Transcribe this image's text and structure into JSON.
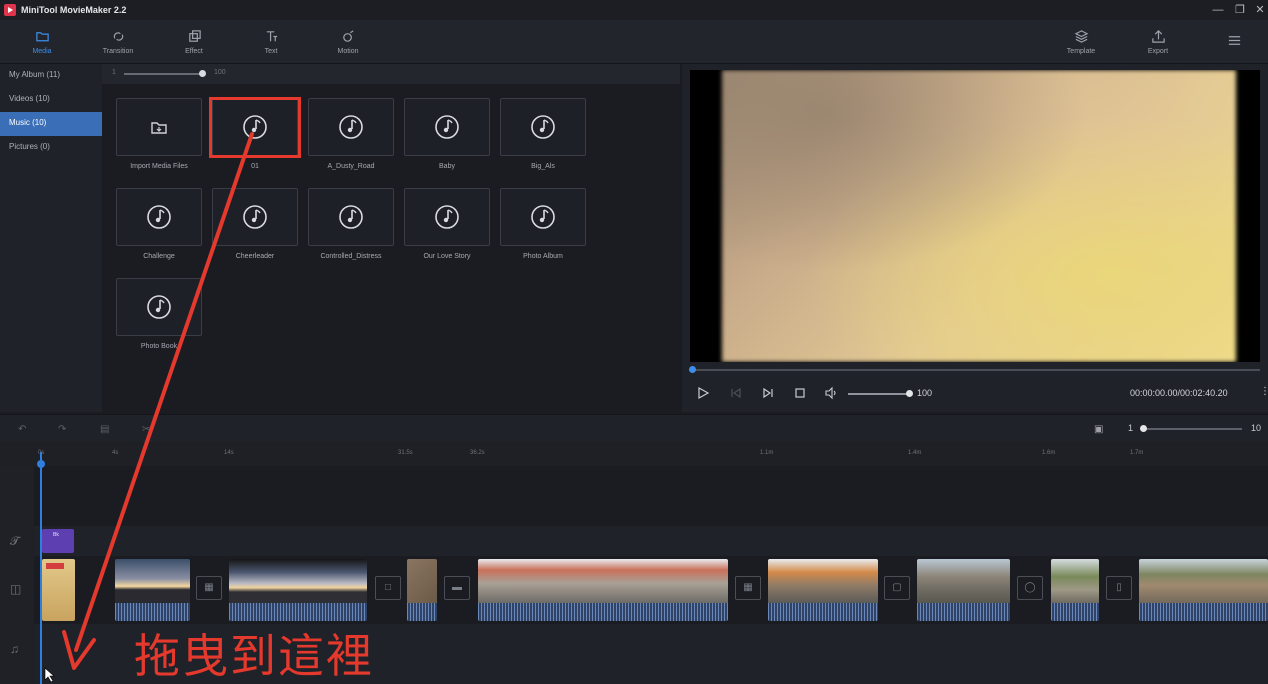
{
  "window": {
    "title": "MiniTool MovieMaker 2.2"
  },
  "toolbar": {
    "items": [
      {
        "label": "Media",
        "icon": "folder-icon",
        "active": true
      },
      {
        "label": "Transition",
        "icon": "transition-icon"
      },
      {
        "label": "Effect",
        "icon": "effect-icon"
      },
      {
        "label": "Text",
        "icon": "text-icon"
      },
      {
        "label": "Motion",
        "icon": "motion-icon"
      }
    ],
    "template_label": "Template",
    "export_label": "Export"
  },
  "leftnav": {
    "items": [
      {
        "label": "My Album  (11)"
      },
      {
        "label": "Videos  (10)"
      },
      {
        "label": "Music  (10)",
        "active": true
      },
      {
        "label": "Pictures  (0)"
      }
    ]
  },
  "media": {
    "zoom_min": "1",
    "zoom_max": "100",
    "tiles": [
      {
        "label": "Import Media Files",
        "icon": "import-folder-icon"
      },
      {
        "label": "01",
        "icon": "music-note-icon",
        "highlighted": true
      },
      {
        "label": "A_Dusty_Road",
        "icon": "music-note-icon"
      },
      {
        "label": "Baby",
        "icon": "music-note-icon"
      },
      {
        "label": "Big_Als",
        "icon": "music-note-icon"
      },
      {
        "label": "Challenge",
        "icon": "music-note-icon"
      },
      {
        "label": "Cheerleader",
        "icon": "music-note-icon"
      },
      {
        "label": "Controlled_Distress",
        "icon": "music-note-icon"
      },
      {
        "label": "Our Love Story",
        "icon": "music-note-icon"
      },
      {
        "label": "Photo Album",
        "icon": "music-note-icon"
      },
      {
        "label": "Photo Book",
        "icon": "music-note-icon"
      }
    ]
  },
  "preview": {
    "progress": 0.0,
    "volume": "100",
    "timecode": "00:00:00.00/00:02:40.20"
  },
  "timeline": {
    "zoom_min": "1",
    "zoom_max": "10",
    "ruler": [
      "0s",
      "4s",
      "14s",
      "31.5s",
      "36.2s",
      "1.1m",
      "1.4m",
      "1.6m",
      "1.7m"
    ],
    "text_clip_label": "Bk"
  },
  "annotation": {
    "drag_hint": "拖曳到這裡",
    "color": "#e4392c"
  }
}
